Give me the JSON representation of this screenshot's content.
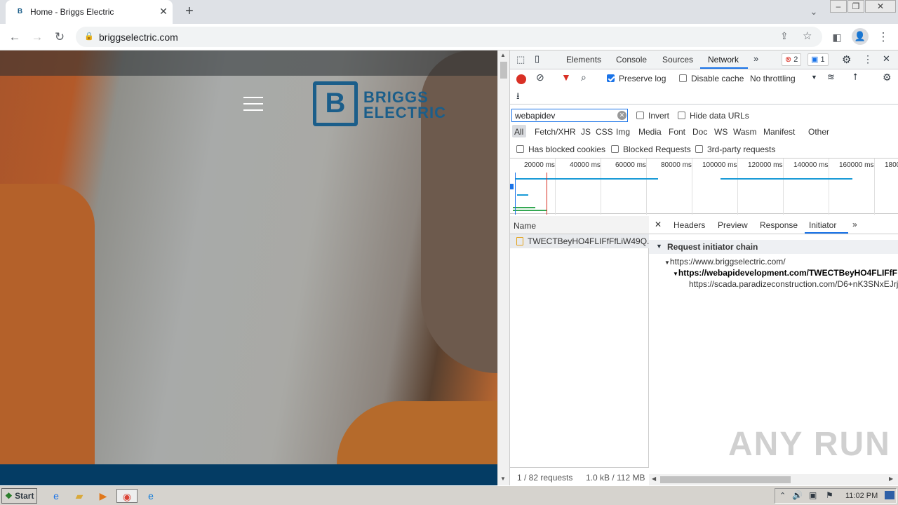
{
  "browser": {
    "tab_title": "Home - Briggs Electric",
    "tab_favicon": "briggs-logo",
    "url": "briggselectric.com"
  },
  "website": {
    "logo_top": "BRIGGS",
    "logo_bottom": "ELECTRIC",
    "brand_color": "#1b5e8a"
  },
  "devtools": {
    "tabs": [
      "Elements",
      "Console",
      "Sources",
      "Network"
    ],
    "selected_tab": "Network",
    "errors_count": "2",
    "messages_count": "1",
    "preserve_log": "Preserve log",
    "disable_cache": "Disable cache",
    "throttling": "No throttling",
    "filter_value": "webapidev",
    "invert": "Invert",
    "hide_data_urls": "Hide data URLs",
    "types": [
      "All",
      "Fetch/XHR",
      "JS",
      "CSS",
      "Img",
      "Media",
      "Font",
      "Doc",
      "WS",
      "Wasm",
      "Manifest",
      "Other"
    ],
    "blocked_cookies": "Has blocked cookies",
    "blocked_requests": "Blocked Requests",
    "third_party": "3rd-party requests",
    "timeline_ticks": [
      "20000 ms",
      "40000 ms",
      "60000 ms",
      "80000 ms",
      "100000 ms",
      "120000 ms",
      "140000 ms",
      "160000 ms",
      "1800"
    ],
    "name_header": "Name",
    "request_name": "TWECTBeyHO4FLIFfFfLiW49Q...",
    "footer_requests": "1 / 82 requests",
    "footer_size": "1.0 kB / 112 MB",
    "detail_tabs": [
      "Headers",
      "Preview",
      "Response",
      "Initiator"
    ],
    "selected_detail_tab": "Initiator",
    "initiator_title": "Request initiator chain",
    "chain": [
      "https://www.briggselectric.com/",
      "https://webapidevelopment.com/TWECTBeyHO4FLIFfF",
      "https://scada.paradizeconstruction.com/D6+nK3SNxEJrj"
    ]
  },
  "watermark": "ANY RUN",
  "taskbar": {
    "start": "Start",
    "clock": "11:02 PM"
  }
}
